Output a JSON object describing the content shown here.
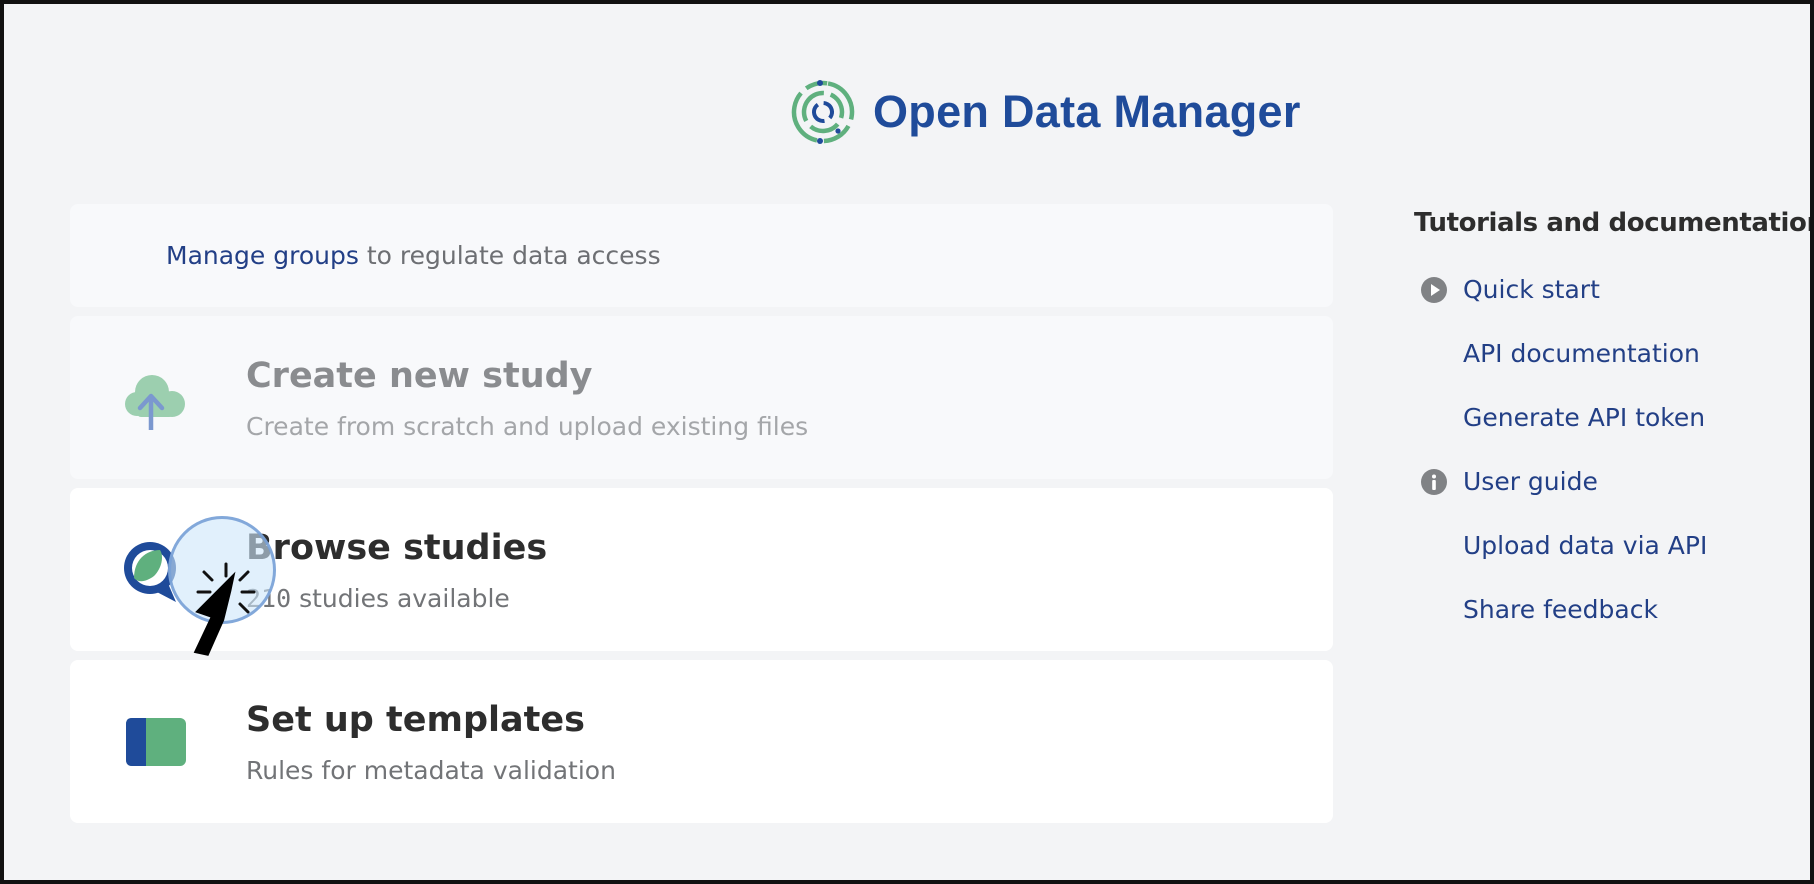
{
  "brand": {
    "name": "Open Data Manager",
    "color": "#1f4b9a",
    "accent": "#5fb07e"
  },
  "groups_card": {
    "link_label": "Manage groups",
    "rest_text": " to regulate data access"
  },
  "cards": [
    {
      "id": "create",
      "icon": "cloud-upload-icon",
      "title": "Create new study",
      "subtitle": "Create from scratch and upload existing files",
      "dimmed": true
    },
    {
      "id": "browse",
      "icon": "search-icon",
      "title": "Browse studies",
      "count": "210",
      "subtitle_rest": " studies available",
      "dimmed": false
    },
    {
      "id": "templates",
      "icon": "template-icon",
      "title": "Set up templates",
      "subtitle": "Rules for metadata validation",
      "dimmed": false
    }
  ],
  "sidebar": {
    "heading": "Tutorials and documentation",
    "links": [
      {
        "label": "Quick start",
        "icon": "play-circle-icon"
      },
      {
        "label": "API documentation",
        "icon": ""
      },
      {
        "label": "Generate API token",
        "icon": ""
      },
      {
        "label": "User guide",
        "icon": "info-circle-icon"
      },
      {
        "label": "Upload data via API",
        "icon": ""
      },
      {
        "label": "Share feedback",
        "icon": ""
      }
    ]
  },
  "colors": {
    "background": "#f3f4f6",
    "link": "#223f86",
    "primary_blue": "#1f4b9a",
    "green": "#5fb07e",
    "icon_grey": "#808285"
  }
}
